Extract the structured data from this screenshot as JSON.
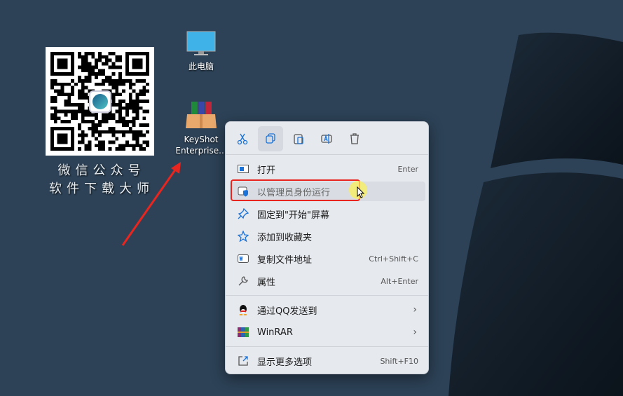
{
  "desktop": {
    "icons": [
      {
        "label": "此电脑",
        "icon": "monitor-icon"
      },
      {
        "label_line1": "KeyShot",
        "label_line2": "Enterprise...",
        "icon": "package-icon"
      }
    ],
    "qr_caption_line1": "微信公众号",
    "qr_caption_line2": "软件下载大师"
  },
  "context_menu": {
    "toolbar": [
      "cut-icon",
      "copy-icon",
      "paste-icon",
      "rename-icon",
      "delete-icon"
    ],
    "items": [
      {
        "label": "打开",
        "shortcut": "Enter"
      },
      {
        "label": "以管理员身份运行",
        "shortcut": ""
      },
      {
        "label": "固定到\"开始\"屏幕",
        "shortcut": ""
      },
      {
        "label": "添加到收藏夹",
        "shortcut": ""
      },
      {
        "label": "复制文件地址",
        "shortcut": "Ctrl+Shift+C"
      },
      {
        "label": "属性",
        "shortcut": "Alt+Enter"
      },
      {
        "label": "通过QQ发送到",
        "shortcut": ""
      },
      {
        "label": "WinRAR",
        "shortcut": ""
      },
      {
        "label": "显示更多选项",
        "shortcut": "Shift+F10"
      }
    ]
  },
  "colors": {
    "accent": "#1a73d9",
    "highlight": "#e8251f",
    "background": "#2d4257"
  }
}
